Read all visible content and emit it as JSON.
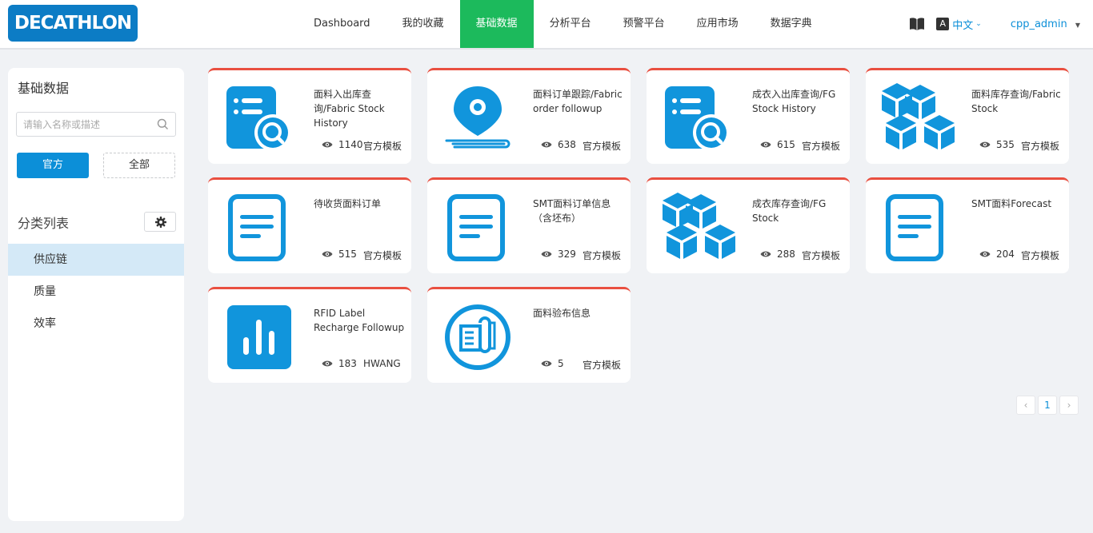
{
  "header": {
    "logo_text": "DECATHLON",
    "nav": [
      {
        "label": "Dashboard",
        "active": false
      },
      {
        "label": "我的收藏",
        "active": false
      },
      {
        "label": "基础数据",
        "active": true
      },
      {
        "label": "分析平台",
        "active": false
      },
      {
        "label": "预警平台",
        "active": false
      },
      {
        "label": "应用市场",
        "active": false
      },
      {
        "label": "数据字典",
        "active": false
      }
    ],
    "language": "中文",
    "user": "cpp_admin"
  },
  "sidebar": {
    "title": "基础数据",
    "search_placeholder": "请输入名称或描述",
    "filter_official": "官方",
    "filter_all": "全部",
    "category_title": "分类列表",
    "categories": [
      {
        "label": "供应链",
        "active": true
      },
      {
        "label": "质量",
        "active": false
      },
      {
        "label": "效率",
        "active": false
      }
    ]
  },
  "cards": [
    {
      "title": "面料入出库查询/Fabric Stock History",
      "views": "1140",
      "tag": "官方模板",
      "icon": "search-list-icon"
    },
    {
      "title": "面料订单跟踪/Fabric order followup",
      "views": "638",
      "tag": "官方模板",
      "icon": "location-pin-icon"
    },
    {
      "title": "成衣入出库查询/FG Stock History",
      "views": "615",
      "tag": "官方模板",
      "icon": "search-list-icon"
    },
    {
      "title": "面料库存查询/Fabric Stock",
      "views": "535",
      "tag": "官方模板",
      "icon": "cubes-icon"
    },
    {
      "title": "待收货面料订单",
      "views": "515",
      "tag": "官方模板",
      "icon": "document-icon"
    },
    {
      "title": "SMT面料订单信息（含坯布）",
      "views": "329",
      "tag": "官方模板",
      "icon": "document-icon"
    },
    {
      "title": "成衣库存查询/FG Stock",
      "views": "288",
      "tag": "官方模板",
      "icon": "cubes-icon"
    },
    {
      "title": "SMT面料Forecast",
      "views": "204",
      "tag": "官方模板",
      "icon": "document-icon"
    },
    {
      "title": "RFID Label Recharge Followup",
      "views": "183",
      "tag": "HWANG",
      "icon": "bar-chart-icon"
    },
    {
      "title": "面料验布信息",
      "views": "5",
      "tag": "官方模板",
      "icon": "fabric-roll-icon"
    }
  ],
  "pagination": {
    "prev": "‹",
    "current": "1",
    "next": "›"
  },
  "colors": {
    "primary": "#0c8fd8",
    "active_nav": "#1cba5c",
    "card_accent": "#e94f40",
    "icon_blue": "#1195dc"
  }
}
